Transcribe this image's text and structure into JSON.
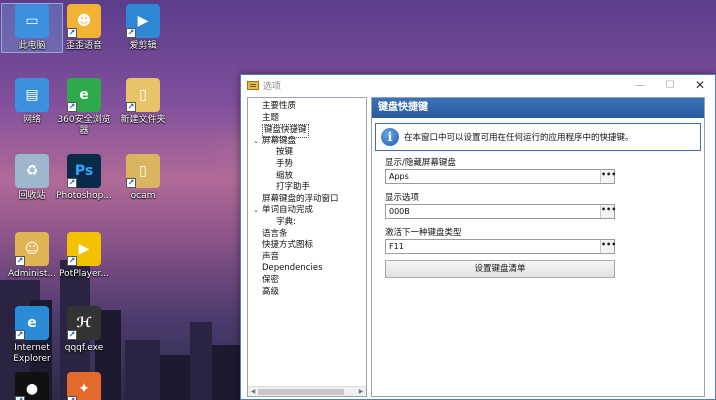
{
  "desktop_icons": [
    {
      "label": "此电脑",
      "icon": "computer-icon"
    },
    {
      "label": "歪歪语音",
      "icon": "yy-voice-icon"
    },
    {
      "label": "爱剪辑",
      "icon": "video-editor-icon"
    },
    {
      "label": "网络",
      "icon": "network-icon"
    },
    {
      "label": "360安全浏览器",
      "icon": "360-browser-icon"
    },
    {
      "label": "新建文件夹",
      "icon": "folder-icon"
    },
    {
      "label": "回收站",
      "icon": "recycle-bin-icon"
    },
    {
      "label": "Photoshop...",
      "icon": "photoshop-icon"
    },
    {
      "label": "ocam",
      "icon": "ocam-icon"
    },
    {
      "label": "Administ...",
      "icon": "user-folder-icon"
    },
    {
      "label": "PotPlayer...",
      "icon": "potplayer-icon"
    },
    {
      "label": "Internet Explorer",
      "icon": "internet-explorer-icon"
    },
    {
      "label": "qqqf.exe",
      "icon": "exe-app-icon"
    },
    {
      "label": "",
      "icon": "qq-icon"
    },
    {
      "label": "",
      "icon": "game-icon"
    }
  ],
  "window": {
    "title": "选项",
    "min": "—",
    "max": "☐",
    "close": "✕"
  },
  "tree": [
    {
      "label": "主要性质",
      "level": 0,
      "expander": ""
    },
    {
      "label": "主题",
      "level": 0,
      "expander": ""
    },
    {
      "label": "键盘快捷键",
      "level": 0,
      "expander": "",
      "selected": true
    },
    {
      "label": "屏幕键盘",
      "level": 0,
      "expander": "⌄"
    },
    {
      "label": "按键",
      "level": 1,
      "expander": ""
    },
    {
      "label": "手势",
      "level": 1,
      "expander": ""
    },
    {
      "label": "缩放",
      "level": 1,
      "expander": ""
    },
    {
      "label": "打字助手",
      "level": 1,
      "expander": ""
    },
    {
      "label": "屏幕键盘的浮动窗口",
      "level": 0,
      "expander": ""
    },
    {
      "label": "单词自动完成",
      "level": 0,
      "expander": "⌄"
    },
    {
      "label": "字典:",
      "level": 1,
      "expander": ""
    },
    {
      "label": "语言条",
      "level": 0,
      "expander": ""
    },
    {
      "label": "快捷方式图标",
      "level": 0,
      "expander": ""
    },
    {
      "label": "声音",
      "level": 0,
      "expander": ""
    },
    {
      "label": "Dependencies",
      "level": 0,
      "expander": ""
    },
    {
      "label": "保密",
      "level": 0,
      "expander": ""
    },
    {
      "label": "高级",
      "level": 0,
      "expander": ""
    }
  ],
  "panel": {
    "title": "键盘快捷键",
    "info": "在本窗口中可以设置可用在任何运行的应用程序中的快捷键。",
    "fields": [
      {
        "label": "显示/隐藏屏幕键盘",
        "value": "Apps"
      },
      {
        "label": "显示选项",
        "value": "000B"
      },
      {
        "label": "激活下一种键盘类型",
        "value": "F11"
      }
    ],
    "ellipsis": "•••",
    "reset_button": "设置键盘清单"
  }
}
